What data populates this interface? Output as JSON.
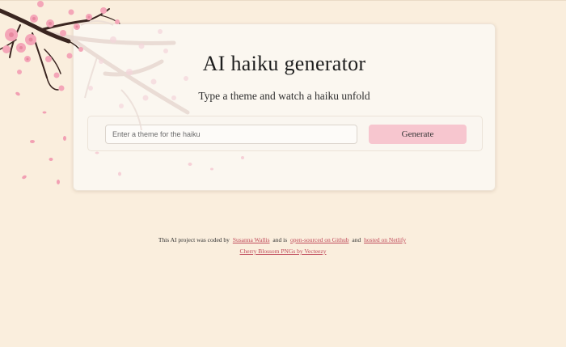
{
  "header": {
    "title": "AI haiku generator",
    "subtitle": "Type a theme and watch a haiku unfold"
  },
  "form": {
    "input_placeholder": "Enter a theme for the haiku",
    "input_value": "",
    "generate_label": "Generate"
  },
  "footer": {
    "text_1": "This AI project was coded by",
    "author_link": "Susanna Wallis",
    "text_2": "and is",
    "github_link": "open-sourced on Github",
    "text_3": "and",
    "netlify_link": "hosted on Netlify",
    "credit_link": "Cherry Blossom PNGs by Vecteezy"
  },
  "colors": {
    "background": "#faeedd",
    "card": "#fbf7f1",
    "button": "#f7c6cf",
    "link": "#c04a5a",
    "blossom": "#f4a6b8",
    "branch": "#3a2520"
  },
  "icons": [
    "cherry-blossom-branch"
  ]
}
